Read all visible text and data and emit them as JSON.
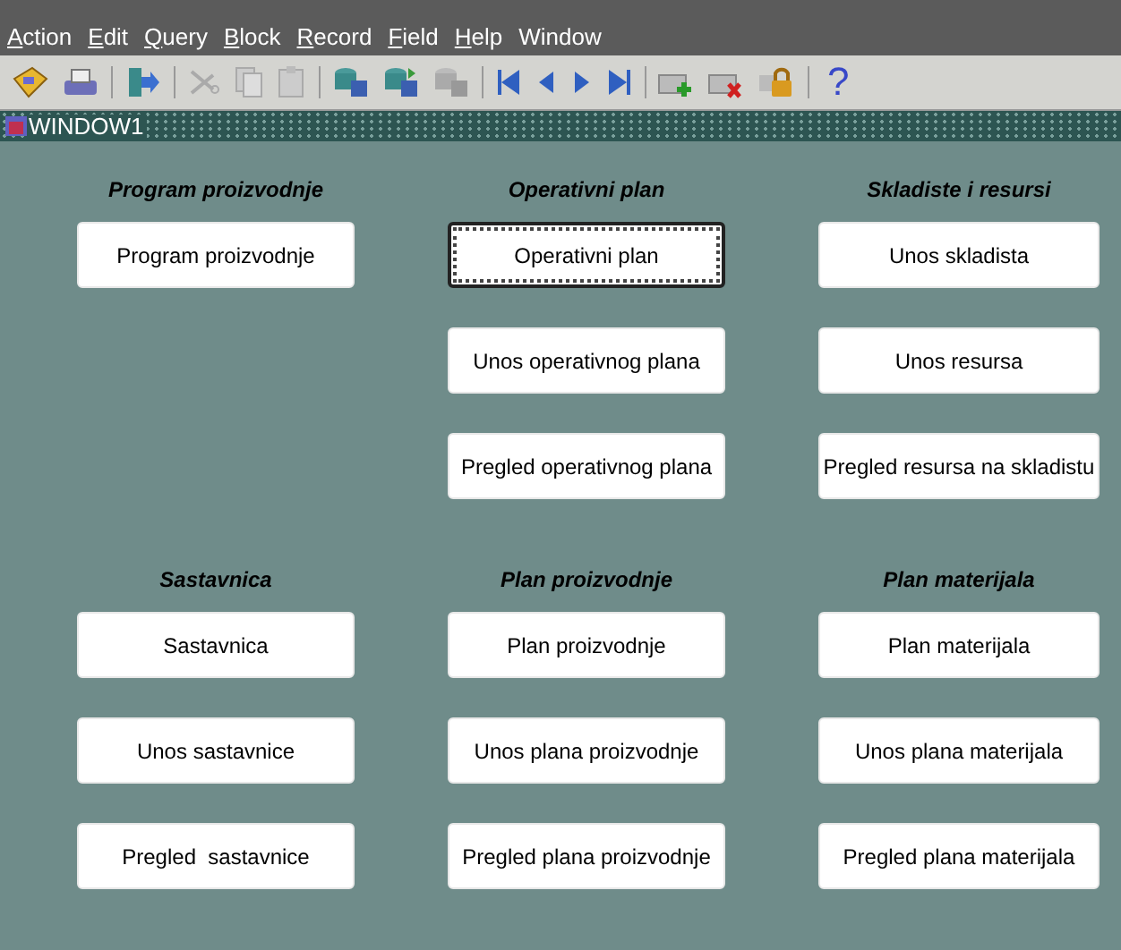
{
  "menu": [
    {
      "label": "Action",
      "mnemonic": true
    },
    {
      "label": "Edit",
      "mnemonic": true
    },
    {
      "label": "Query",
      "mnemonic": true
    },
    {
      "label": "Block",
      "mnemonic": true
    },
    {
      "label": "Record",
      "mnemonic": true
    },
    {
      "label": "Field",
      "mnemonic": true
    },
    {
      "label": "Help",
      "mnemonic": true
    },
    {
      "label": "Window",
      "mnemonic": false
    }
  ],
  "toolbar": {
    "help_glyph": "?"
  },
  "window": {
    "title": "WINDOW1"
  },
  "groups": [
    {
      "heading": "Program proizvodnje",
      "buttons": [
        {
          "label": "Program proizvodnje",
          "focused": false
        }
      ]
    },
    {
      "heading": "Operativni plan",
      "buttons": [
        {
          "label": "Operativni plan",
          "focused": true
        },
        {
          "label": "Unos operativnog plana",
          "focused": false
        },
        {
          "label": "Pregled operativnog plana",
          "focused": false
        }
      ]
    },
    {
      "heading": "Skladiste i resursi",
      "buttons": [
        {
          "label": "Unos skladista",
          "focused": false
        },
        {
          "label": "Unos resursa",
          "focused": false
        },
        {
          "label": "Pregled resursa na skladistu",
          "focused": false
        }
      ]
    },
    {
      "heading": "Sastavnica",
      "buttons": [
        {
          "label": "Sastavnica",
          "focused": false
        },
        {
          "label": "Unos sastavnice",
          "focused": false
        },
        {
          "label": "Pregled  sastavnice",
          "focused": false
        }
      ]
    },
    {
      "heading": "Plan proizvodnje",
      "buttons": [
        {
          "label": "Plan proizvodnje",
          "focused": false
        },
        {
          "label": "Unos plana proizvodnje",
          "focused": false
        },
        {
          "label": "Pregled plana proizvodnje",
          "focused": false
        }
      ]
    },
    {
      "heading": "Plan materijala",
      "buttons": [
        {
          "label": "Plan materijala",
          "focused": false
        },
        {
          "label": "Unos plana materijala",
          "focused": false
        },
        {
          "label": "Pregled plana materijala",
          "focused": false
        }
      ]
    }
  ]
}
